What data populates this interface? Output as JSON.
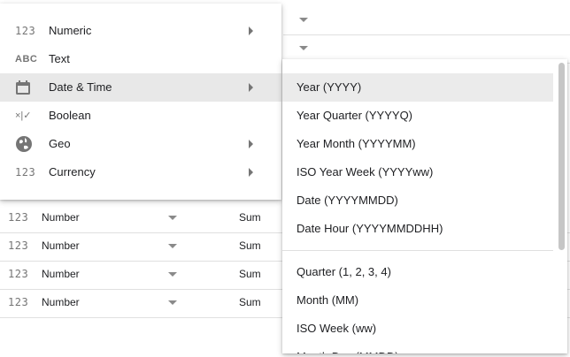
{
  "type_menu": {
    "items": [
      {
        "icon": "123",
        "icon_name": "numeric-icon",
        "label": "Numeric",
        "has_submenu": true
      },
      {
        "icon": "ABC",
        "icon_name": "text-icon",
        "label": "Text",
        "has_submenu": false
      },
      {
        "icon": "",
        "icon_name": "calendar-icon",
        "label": "Date & Time",
        "has_submenu": true,
        "selected": true
      },
      {
        "icon": "×|✓",
        "icon_name": "boolean-icon",
        "label": "Boolean",
        "has_submenu": false
      },
      {
        "icon": "",
        "icon_name": "globe-icon",
        "label": "Geo",
        "has_submenu": true
      },
      {
        "icon": "123",
        "icon_name": "currency-icon",
        "label": "Currency",
        "has_submenu": true
      }
    ]
  },
  "date_submenu": {
    "items": [
      "Year (YYYY)",
      "Year Quarter (YYYYQ)",
      "Year Month (YYYYMM)",
      "ISO Year Week (YYYYww)",
      "Date (YYYYMMDD)",
      "Date Hour (YYYYMMDDHH)",
      "Quarter (1, 2, 3, 4)",
      "Month (MM)",
      "ISO Week (ww)",
      "Month Day (MMDD)"
    ],
    "selected_index": 0
  },
  "field_rows": [
    {
      "icon": "123",
      "type": "Number",
      "aggregation": "Sum"
    },
    {
      "icon": "123",
      "type": "Number",
      "aggregation": "Sum"
    },
    {
      "icon": "123",
      "type": "Number",
      "aggregation": "Sum"
    },
    {
      "icon": "123",
      "type": "Number",
      "aggregation": "Sum"
    }
  ],
  "colors": {
    "selected_bg": "#e8e8e8",
    "icon_gray": "#757575",
    "divider": "#e0e0e0"
  }
}
